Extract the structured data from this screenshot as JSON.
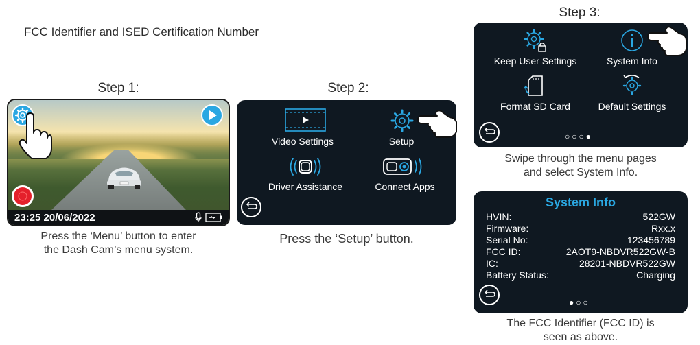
{
  "title": "FCC Identifier and ISED Certification Number",
  "step1": {
    "label": "Step 1:",
    "timestamp": "23:25 20/06/2022",
    "caption_line1": "Press the ‘Menu’ button to enter",
    "caption_line2": "the Dash Cam’s menu system.",
    "icons": [
      "gear-icon",
      "play-icon",
      "record-icon",
      "microphone-icon",
      "battery-charging-icon",
      "pointing-hand-icon"
    ]
  },
  "step2": {
    "label": "Step 2:",
    "items": [
      "Video Settings",
      "Setup",
      "Driver Assistance",
      "Connect Apps"
    ],
    "caption": "Press the ‘Setup’ button."
  },
  "step3": {
    "label": "Step 3:",
    "items": [
      "Keep User Settings",
      "System Info",
      "Format SD Card",
      "Default Settings"
    ],
    "page_dots": "○○○●",
    "caption_line1": "Swipe through the menu pages",
    "caption_line2": "and select System Info."
  },
  "system_info": {
    "title": "System Info",
    "rows": [
      {
        "key": "HVIN:",
        "value": "522GW"
      },
      {
        "key": "Firmware:",
        "value": "Rxx.x"
      },
      {
        "key": "Serial No:",
        "value": "123456789"
      },
      {
        "key": "FCC ID:",
        "value": "2AOT9-NBDVR522GW-B"
      },
      {
        "key": "IC:",
        "value": "28201-NBDVR522GW"
      },
      {
        "key": "Battery Status:",
        "value": "Charging"
      }
    ],
    "page_dots": "●○○",
    "caption_line1": "The FCC Identifier (FCC ID) is",
    "caption_line2": "seen as above."
  },
  "colors": {
    "accent": "#2aa7e2",
    "screen_bg": "#0f1821",
    "record": "#e4202b"
  }
}
